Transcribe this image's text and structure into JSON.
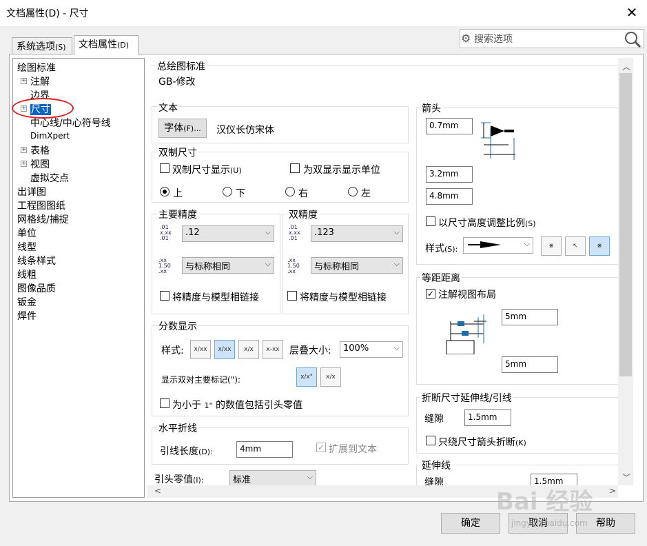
{
  "window": {
    "title": "文档属性(D) - 尺寸",
    "close": "✕"
  },
  "tabs": [
    {
      "label": "系统选项",
      "hotkey": "(S)"
    },
    {
      "label": "文档属性",
      "hotkey": "(D)"
    }
  ],
  "search": {
    "placeholder": "搜索选项"
  },
  "tree": {
    "items": [
      "绘图标准",
      "注解",
      "边界",
      "尺寸",
      "中心线/中心符号线",
      "DimXpert",
      "表格",
      "视图",
      "虚拟交点",
      "出详图",
      "工程图图纸",
      "网格线/捕捉",
      "单位",
      "线型",
      "线条样式",
      "线粗",
      "图像品质",
      "钣金",
      "焊件"
    ]
  },
  "overall_standard": {
    "title": "总绘图标准",
    "value": "GB-修改"
  },
  "text_group": {
    "title": "文本",
    "font_button": "字体",
    "font_hotkey": "(F)...",
    "font_name": "汉仪长仿宋体"
  },
  "dual": {
    "title": "双制尺寸",
    "show_label": "双制尺寸显示",
    "show_hotkey": "(U)",
    "units_label": "为双显示显示单位",
    "positions": [
      "上",
      "下",
      "右",
      "左"
    ]
  },
  "primary_precision": {
    "title": "主要精度",
    "value1": ".12",
    "value2": "与标称相同",
    "link_label": "将精度与模型相链接"
  },
  "dual_precision": {
    "title": "双精度",
    "value1": ".123",
    "value2": "与标称相同",
    "link_label": "将精度与模型相链接"
  },
  "fraction": {
    "title": "分数显示",
    "style_label": "样式:",
    "stack_label": "层叠大小:",
    "stack_value": "100%",
    "dual_mark_label": "显示双对主要标记(\"):",
    "leading_zero_a": "为小于 ",
    "leading_zero_b": "1\"",
    "leading_zero_c": " 的数值包括引头零值",
    "style_icons": [
      "x/xx",
      "x/xx",
      "x/x",
      "x-xx"
    ],
    "mark_icons": [
      "x/x\"",
      "x/x"
    ]
  },
  "horizontal": {
    "title": "水平折线",
    "leader_label": "引线长度",
    "leader_hotkey": "(D):",
    "leader_value": "4mm",
    "extend_label": "扩展到文本"
  },
  "leading_zero": {
    "label": "引头零值",
    "hotkey": "(I):",
    "value": "标准"
  },
  "arrows": {
    "title": "箭头",
    "v1": "0.7mm",
    "v2": "3.2mm",
    "v3": "4.8mm",
    "scale_label": "以尺寸高度调整比例",
    "scale_hotkey": "(S)",
    "style_label": "样式",
    "style_hotkey": "(S):"
  },
  "offset": {
    "title": "等距距离",
    "annot_label": "注解视图布局",
    "v1": "5mm",
    "v2": "5mm"
  },
  "break_dim": {
    "title": "折断尺寸延伸线/引线",
    "gap_label": "缝隙",
    "gap_value": "1.5mm",
    "only_label": "只绕尺寸箭头折断",
    "only_hotkey": "(K)"
  },
  "extension": {
    "title": "延伸线",
    "gap_label": "缝隙",
    "gap_value": "1.5mm"
  },
  "footer": {
    "ok": "确定",
    "cancel": "取消",
    "help": "帮助"
  },
  "watermark": {
    "main": "Bai 经验",
    "sub": "jingyan.baidu.com"
  },
  "colors": {
    "selection": "#0a63c9",
    "annotation_circle": "#e02020",
    "ok_border": "#0078d7"
  }
}
